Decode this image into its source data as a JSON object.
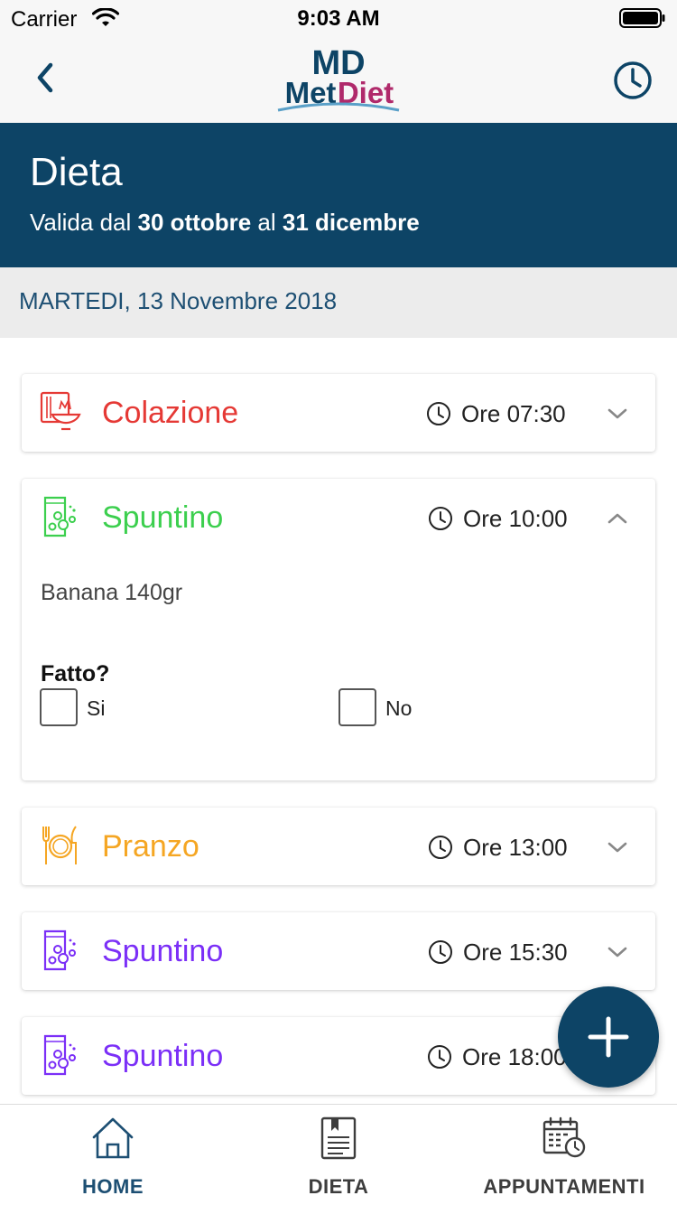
{
  "status_bar": {
    "carrier": "Carrier",
    "time": "9:03 AM"
  },
  "nav": {
    "logo_top": "MD",
    "logo_text_left": "Met",
    "logo_text_right": "Diet",
    "back_icon": "chevron-left-icon",
    "history_icon": "clock-icon"
  },
  "header": {
    "title": "Dieta",
    "subtitle_prefix": "Valida dal",
    "start_date": "30 ottobre",
    "subtitle_middle": "al",
    "end_date": "31 dicembre"
  },
  "date": "MARTEDI, 13 Novembre 2018",
  "meals": [
    {
      "name": "Colazione",
      "time": "Ore 07:30",
      "color": "#e53935",
      "icon": "breakfast-bowl-icon",
      "expanded": false
    },
    {
      "name": "Spuntino",
      "time": "Ore 10:00",
      "color": "#3ccf4e",
      "icon": "snack-bag-icon",
      "expanded": true
    },
    {
      "name": "Pranzo",
      "time": "Ore 13:00",
      "color": "#f5a623",
      "icon": "plate-cutlery-icon",
      "expanded": false
    },
    {
      "name": "Spuntino",
      "time": "Ore 15:30",
      "color": "#7b2ff7",
      "icon": "snack-bag-icon",
      "expanded": false
    },
    {
      "name": "Spuntino",
      "time": "Ore 18:00",
      "color": "#7b2ff7",
      "icon": "snack-bag-icon",
      "expanded": false
    }
  ],
  "expanded_meal": {
    "food": "Banana 140gr",
    "done_question": "Fatto?",
    "option_yes": "Si",
    "option_no": "No",
    "yes_checked": false,
    "no_checked": false
  },
  "fab": {
    "icon": "plus-icon"
  },
  "tabs": [
    {
      "label": "HOME",
      "icon": "home-icon",
      "active": true
    },
    {
      "label": "DIETA",
      "icon": "document-icon",
      "active": false
    },
    {
      "label": "APPUNTAMENTI",
      "icon": "calendar-clock-icon",
      "active": false
    }
  ],
  "colors": {
    "primary": "#0d4466",
    "tab_active": "#1d4f73",
    "tab_inactive": "#3d3d3d"
  }
}
